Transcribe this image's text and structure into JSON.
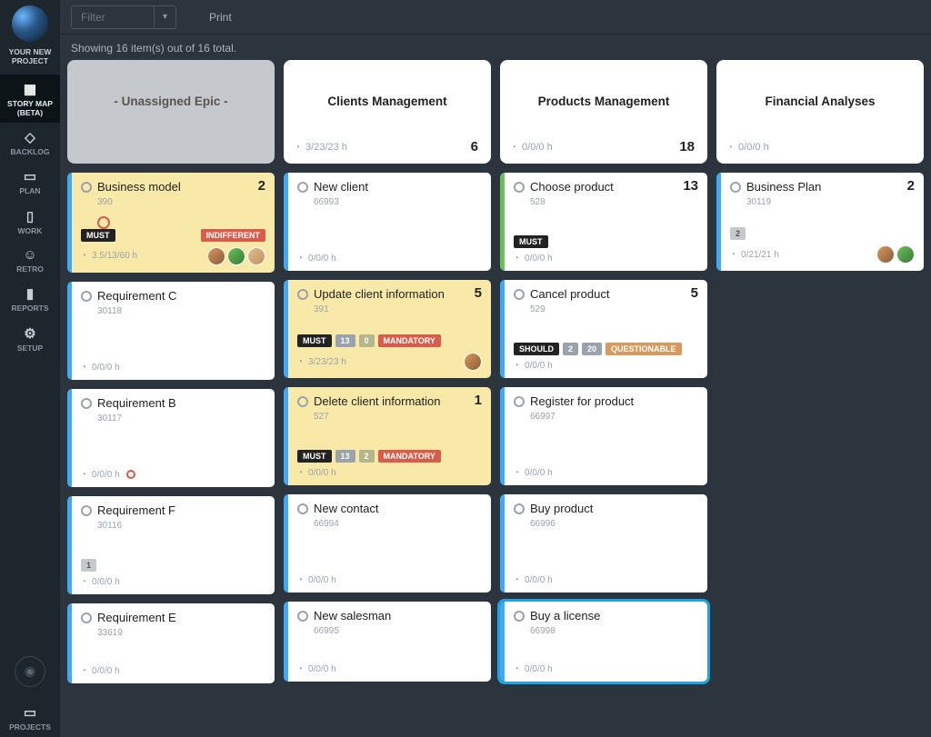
{
  "project_name": "YOUR NEW PROJECT",
  "nav": [
    {
      "label": "STORY MAP (BETA)",
      "icon": "▦",
      "active": true
    },
    {
      "label": "BACKLOG",
      "icon": "◇"
    },
    {
      "label": "PLAN",
      "icon": "▭"
    },
    {
      "label": "WORK",
      "icon": "▯"
    },
    {
      "label": "RETRO",
      "icon": "☺"
    },
    {
      "label": "REPORTS",
      "icon": "▮"
    },
    {
      "label": "SETUP",
      "icon": "⚙"
    }
  ],
  "bottom_nav": {
    "projects": "PROJECTS"
  },
  "toolbar": {
    "filter_placeholder": "Filter",
    "print": "Print"
  },
  "status": "Showing 16 item(s) out of 16 total.",
  "epics": [
    {
      "title": "- Unassigned Epic -",
      "time": "",
      "count": "",
      "unassigned": true
    },
    {
      "title": "Clients Management",
      "time": "3/23/23 h",
      "count": "6"
    },
    {
      "title": "Products Management",
      "time": "0/0/0 h",
      "count": "18"
    },
    {
      "title": "Financial Analyses",
      "time": "0/0/0 h",
      "count": ""
    }
  ],
  "cards": {
    "c0": [
      {
        "title": "Business model",
        "id": "390",
        "points": "2",
        "yellow": true,
        "extra_ring": true,
        "tags": [
          {
            "t": "MUST",
            "c": ""
          },
          {
            "t": "INDIFFERENT",
            "c": "red",
            "right": true
          }
        ],
        "time": "3.5/13/60 h",
        "avatars": 3
      },
      {
        "title": "Requirement C",
        "id": "30118",
        "time": "0/0/0 h"
      },
      {
        "title": "Requirement B",
        "id": "30117",
        "time": "0/0/0 h",
        "red_ring": true
      },
      {
        "title": "Requirement F",
        "id": "30116",
        "time": "0/0/0 h",
        "tags": [
          {
            "t": "1",
            "c": "light"
          }
        ]
      },
      {
        "title": "Requirement E",
        "id": "33619",
        "time": "0/0/0 h",
        "short": true
      }
    ],
    "c1": [
      {
        "title": "New client",
        "id": "66993",
        "time": "0/0/0 h"
      },
      {
        "title": "Update client information",
        "id": "391",
        "points": "5",
        "yellow": true,
        "tags": [
          {
            "t": "MUST",
            "c": ""
          },
          {
            "t": "13",
            "c": "gray"
          },
          {
            "t": "0",
            "c": "olive"
          },
          {
            "t": "MANDATORY",
            "c": "red"
          }
        ],
        "time": "3/23/23 h",
        "avatars": 1
      },
      {
        "title": "Delete client information",
        "id": "527",
        "points": "1",
        "yellow": true,
        "tags": [
          {
            "t": "MUST",
            "c": ""
          },
          {
            "t": "13",
            "c": "gray"
          },
          {
            "t": "2",
            "c": "olive"
          },
          {
            "t": "MANDATORY",
            "c": "red"
          }
        ],
        "time": "0/0/0 h"
      },
      {
        "title": "New contact",
        "id": "66994",
        "time": "0/0/0 h"
      },
      {
        "title": "New salesman",
        "id": "66995",
        "time": "0/0/0 h",
        "short": true
      }
    ],
    "c2": [
      {
        "title": "Choose product",
        "id": "528",
        "points": "13",
        "green": true,
        "tags": [
          {
            "t": "MUST",
            "c": ""
          }
        ],
        "time": "0/0/0 h"
      },
      {
        "title": "Cancel product",
        "id": "529",
        "points": "5",
        "tags": [
          {
            "t": "SHOULD",
            "c": ""
          },
          {
            "t": "2",
            "c": "gray"
          },
          {
            "t": "20",
            "c": "gray"
          },
          {
            "t": "QUESTIONABLE",
            "c": "orange"
          }
        ],
        "time": "0/0/0 h"
      },
      {
        "title": "Register for product",
        "id": "66997",
        "time": "0/0/0 h"
      },
      {
        "title": "Buy product",
        "id": "66996",
        "time": "0/0/0 h"
      },
      {
        "title": "Buy a license",
        "id": "66998",
        "time": "0/0/0 h",
        "selected": true,
        "short": true
      }
    ],
    "c3": [
      {
        "title": "Business Plan",
        "id": "30119",
        "points": "2",
        "tags": [
          {
            "t": "2",
            "c": "light"
          }
        ],
        "time": "0/21/21 h",
        "avatars": 2
      }
    ]
  }
}
